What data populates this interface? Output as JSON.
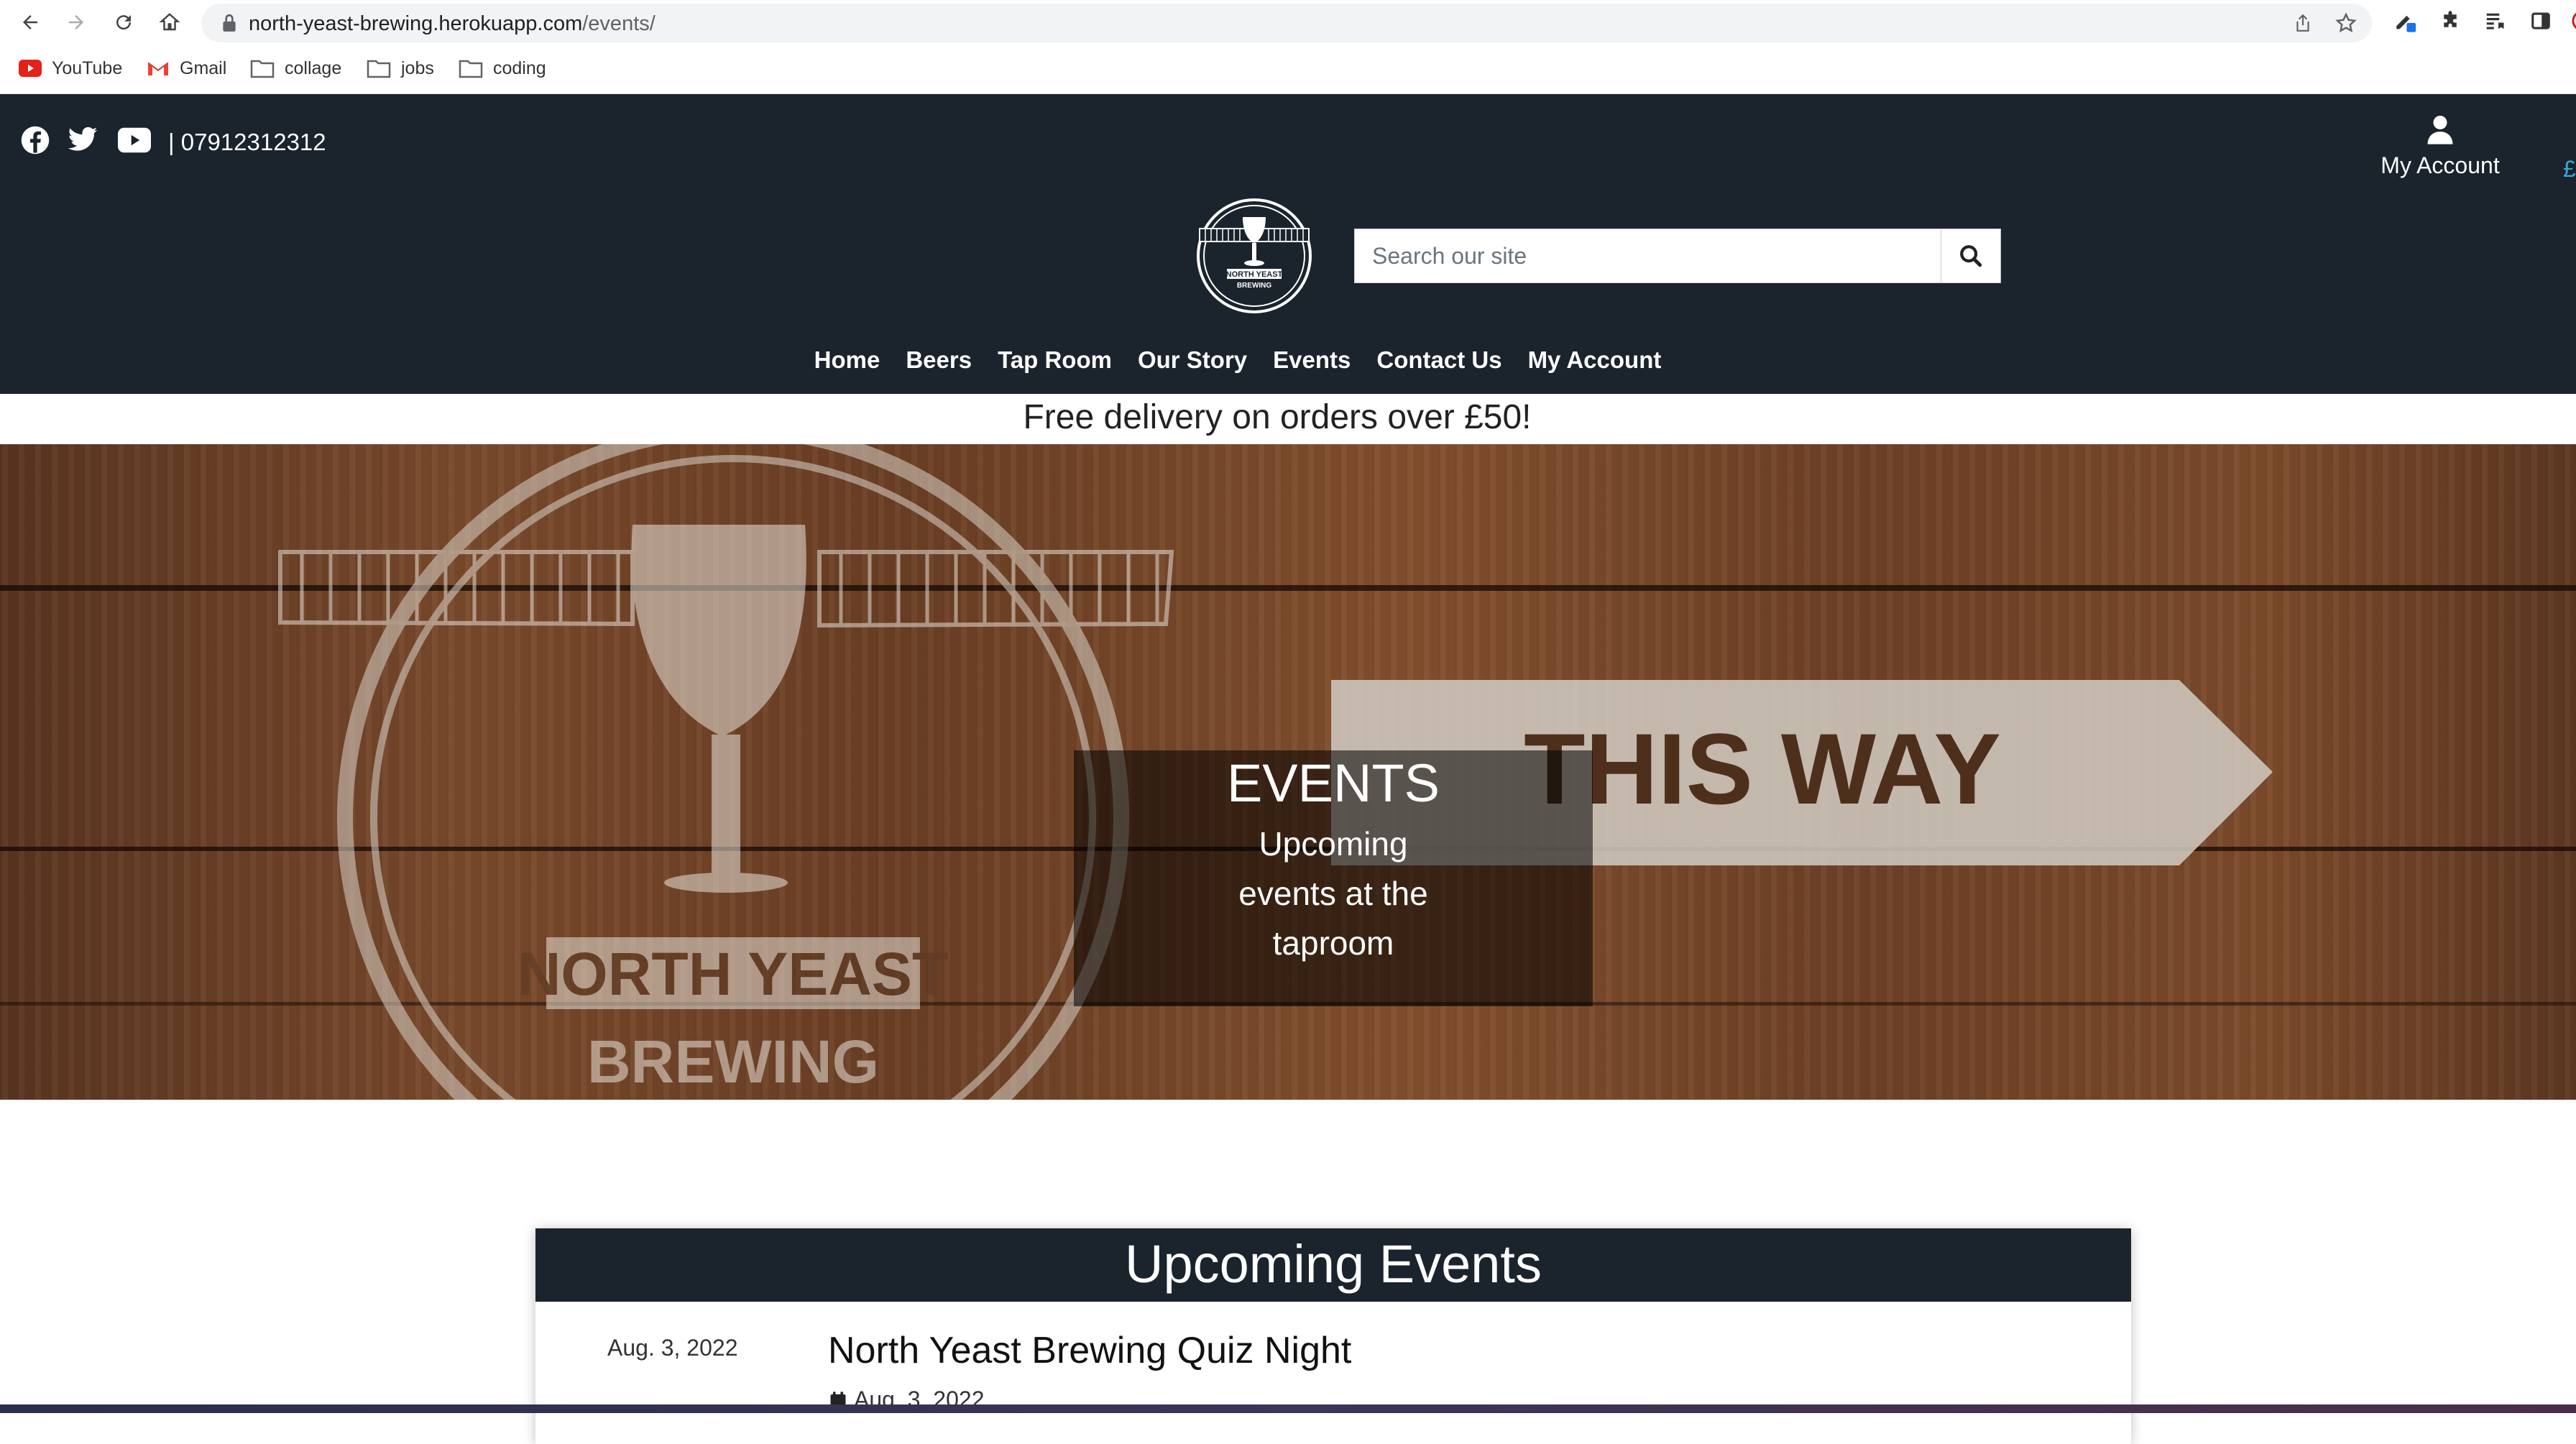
{
  "browser": {
    "url_host": "north-yeast-brewing.herokuapp.com",
    "url_path": "/events/",
    "bookmarks": [
      {
        "label": "YouTube",
        "icon": "youtube-icon"
      },
      {
        "label": "Gmail",
        "icon": "gmail-icon"
      },
      {
        "label": "collage",
        "icon": "folder-icon"
      },
      {
        "label": "jobs",
        "icon": "folder-icon"
      },
      {
        "label": "coding",
        "icon": "folder-icon"
      }
    ]
  },
  "header": {
    "phone": "| 07912312312",
    "account_label": "My Account",
    "currency_symbol": "£",
    "search_placeholder": "Search our site",
    "logo_text_top": "NORTH YEAST",
    "logo_text_bottom": "BREWING",
    "nav": [
      "Home",
      "Beers",
      "Tap Room",
      "Our Story",
      "Events",
      "Contact Us",
      "My Account"
    ]
  },
  "banner": {
    "delivery": "Free delivery on orders over £50!"
  },
  "hero": {
    "title": "EVENTS",
    "subtitle": "Upcoming events at the taproom",
    "sign_text": "THIS WAY",
    "logo_text_top": "NORTH YEAST",
    "logo_text_bottom": "BREWING"
  },
  "events": {
    "heading": "Upcoming Events",
    "items": [
      {
        "date": "Aug. 3, 2022",
        "name": "North Yeast Brewing Quiz Night",
        "subdate": "Aug. 3, 2022"
      }
    ]
  },
  "colors": {
    "header_bg": "#1b232c",
    "accent_blue": "#3aa8d8"
  }
}
